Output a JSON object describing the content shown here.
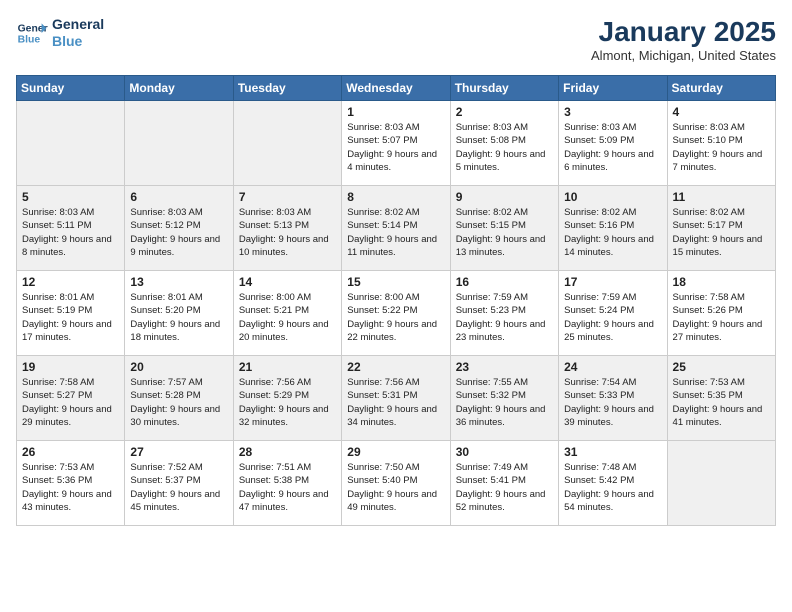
{
  "header": {
    "logo_line1": "General",
    "logo_line2": "Blue",
    "month": "January 2025",
    "location": "Almont, Michigan, United States"
  },
  "weekdays": [
    "Sunday",
    "Monday",
    "Tuesday",
    "Wednesday",
    "Thursday",
    "Friday",
    "Saturday"
  ],
  "weeks": [
    [
      {
        "day": "",
        "empty": true
      },
      {
        "day": "",
        "empty": true
      },
      {
        "day": "",
        "empty": true
      },
      {
        "day": "1",
        "sunrise": "8:03 AM",
        "sunset": "5:07 PM",
        "daylight": "9 hours and 4 minutes."
      },
      {
        "day": "2",
        "sunrise": "8:03 AM",
        "sunset": "5:08 PM",
        "daylight": "9 hours and 5 minutes."
      },
      {
        "day": "3",
        "sunrise": "8:03 AM",
        "sunset": "5:09 PM",
        "daylight": "9 hours and 6 minutes."
      },
      {
        "day": "4",
        "sunrise": "8:03 AM",
        "sunset": "5:10 PM",
        "daylight": "9 hours and 7 minutes."
      }
    ],
    [
      {
        "day": "5",
        "sunrise": "8:03 AM",
        "sunset": "5:11 PM",
        "daylight": "9 hours and 8 minutes."
      },
      {
        "day": "6",
        "sunrise": "8:03 AM",
        "sunset": "5:12 PM",
        "daylight": "9 hours and 9 minutes."
      },
      {
        "day": "7",
        "sunrise": "8:03 AM",
        "sunset": "5:13 PM",
        "daylight": "9 hours and 10 minutes."
      },
      {
        "day": "8",
        "sunrise": "8:02 AM",
        "sunset": "5:14 PM",
        "daylight": "9 hours and 11 minutes."
      },
      {
        "day": "9",
        "sunrise": "8:02 AM",
        "sunset": "5:15 PM",
        "daylight": "9 hours and 13 minutes."
      },
      {
        "day": "10",
        "sunrise": "8:02 AM",
        "sunset": "5:16 PM",
        "daylight": "9 hours and 14 minutes."
      },
      {
        "day": "11",
        "sunrise": "8:02 AM",
        "sunset": "5:17 PM",
        "daylight": "9 hours and 15 minutes."
      }
    ],
    [
      {
        "day": "12",
        "sunrise": "8:01 AM",
        "sunset": "5:19 PM",
        "daylight": "9 hours and 17 minutes."
      },
      {
        "day": "13",
        "sunrise": "8:01 AM",
        "sunset": "5:20 PM",
        "daylight": "9 hours and 18 minutes."
      },
      {
        "day": "14",
        "sunrise": "8:00 AM",
        "sunset": "5:21 PM",
        "daylight": "9 hours and 20 minutes."
      },
      {
        "day": "15",
        "sunrise": "8:00 AM",
        "sunset": "5:22 PM",
        "daylight": "9 hours and 22 minutes."
      },
      {
        "day": "16",
        "sunrise": "7:59 AM",
        "sunset": "5:23 PM",
        "daylight": "9 hours and 23 minutes."
      },
      {
        "day": "17",
        "sunrise": "7:59 AM",
        "sunset": "5:24 PM",
        "daylight": "9 hours and 25 minutes."
      },
      {
        "day": "18",
        "sunrise": "7:58 AM",
        "sunset": "5:26 PM",
        "daylight": "9 hours and 27 minutes."
      }
    ],
    [
      {
        "day": "19",
        "sunrise": "7:58 AM",
        "sunset": "5:27 PM",
        "daylight": "9 hours and 29 minutes."
      },
      {
        "day": "20",
        "sunrise": "7:57 AM",
        "sunset": "5:28 PM",
        "daylight": "9 hours and 30 minutes."
      },
      {
        "day": "21",
        "sunrise": "7:56 AM",
        "sunset": "5:29 PM",
        "daylight": "9 hours and 32 minutes."
      },
      {
        "day": "22",
        "sunrise": "7:56 AM",
        "sunset": "5:31 PM",
        "daylight": "9 hours and 34 minutes."
      },
      {
        "day": "23",
        "sunrise": "7:55 AM",
        "sunset": "5:32 PM",
        "daylight": "9 hours and 36 minutes."
      },
      {
        "day": "24",
        "sunrise": "7:54 AM",
        "sunset": "5:33 PM",
        "daylight": "9 hours and 39 minutes."
      },
      {
        "day": "25",
        "sunrise": "7:53 AM",
        "sunset": "5:35 PM",
        "daylight": "9 hours and 41 minutes."
      }
    ],
    [
      {
        "day": "26",
        "sunrise": "7:53 AM",
        "sunset": "5:36 PM",
        "daylight": "9 hours and 43 minutes."
      },
      {
        "day": "27",
        "sunrise": "7:52 AM",
        "sunset": "5:37 PM",
        "daylight": "9 hours and 45 minutes."
      },
      {
        "day": "28",
        "sunrise": "7:51 AM",
        "sunset": "5:38 PM",
        "daylight": "9 hours and 47 minutes."
      },
      {
        "day": "29",
        "sunrise": "7:50 AM",
        "sunset": "5:40 PM",
        "daylight": "9 hours and 49 minutes."
      },
      {
        "day": "30",
        "sunrise": "7:49 AM",
        "sunset": "5:41 PM",
        "daylight": "9 hours and 52 minutes."
      },
      {
        "day": "31",
        "sunrise": "7:48 AM",
        "sunset": "5:42 PM",
        "daylight": "9 hours and 54 minutes."
      },
      {
        "day": "",
        "empty": true
      }
    ]
  ],
  "row_shading": [
    false,
    true,
    false,
    true,
    false
  ]
}
